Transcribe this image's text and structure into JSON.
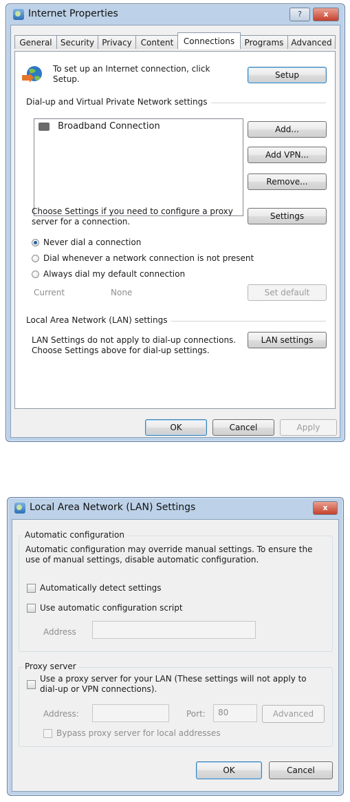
{
  "internet_properties": {
    "title": "Internet Properties",
    "help_symbol": "?",
    "close_symbol": "x",
    "tabs": [
      {
        "label": "General"
      },
      {
        "label": "Security"
      },
      {
        "label": "Privacy"
      },
      {
        "label": "Content"
      },
      {
        "label": "Connections"
      },
      {
        "label": "Programs"
      },
      {
        "label": "Advanced"
      }
    ],
    "active_tab": "Connections",
    "setup_text_line1": "To set up an Internet connection, click",
    "setup_text_line2": "Setup.",
    "setup_button": "Setup",
    "dialup_section_label": "Dial-up and Virtual Private Network settings",
    "connections": [
      "Broadband Connection"
    ],
    "add_button": "Add...",
    "add_vpn_button": "Add VPN...",
    "remove_button": "Remove...",
    "proxy_text_line1": "Choose Settings if you need to configure a proxy",
    "proxy_text_line2": "server for a connection.",
    "settings_button": "Settings",
    "dial_options": [
      {
        "label": "Never dial a connection",
        "checked": true
      },
      {
        "label": "Dial whenever a network connection is not present",
        "checked": false
      },
      {
        "label": "Always dial my default connection",
        "checked": false
      }
    ],
    "current_label": "Current",
    "current_value": "None",
    "set_default_button": "Set default",
    "lan_section_label": "Local Area Network (LAN) settings",
    "lan_text_line1": "LAN Settings do not apply to dial-up connections.",
    "lan_text_line2": "Choose Settings above for dial-up settings.",
    "lan_settings_button": "LAN settings",
    "ok_button": "OK",
    "cancel_button": "Cancel",
    "apply_button": "Apply"
  },
  "lan_settings": {
    "title": "Local Area Network (LAN) Settings",
    "close_symbol": "x",
    "auto_config_label": "Automatic configuration",
    "auto_config_desc_line1": "Automatic configuration may override manual settings.  To ensure the",
    "auto_config_desc_line2": "use of manual settings, disable automatic configuration.",
    "auto_detect_label": "Automatically detect settings",
    "auto_detect_checked": false,
    "auto_script_label": "Use automatic configuration script",
    "auto_script_checked": false,
    "address_label": "Address",
    "address_value": "",
    "proxy_label": "Proxy server",
    "use_proxy_line1": "Use a proxy server for your LAN (These settings will not apply to",
    "use_proxy_line2": "dial-up or VPN connections).",
    "use_proxy_checked": false,
    "proxy_address_label": "Address:",
    "proxy_address_value": "",
    "port_label": "Port:",
    "port_value": "80",
    "advanced_button": "Advanced",
    "bypass_label": "Bypass proxy server for local addresses",
    "bypass_checked": false,
    "ok_button": "OK",
    "cancel_button": "Cancel"
  }
}
